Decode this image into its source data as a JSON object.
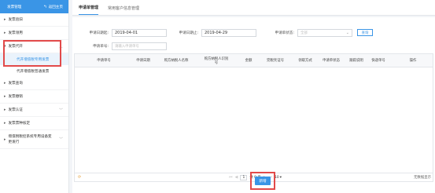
{
  "sidebar": {
    "title": "发票管理",
    "back_label": "返回主页",
    "items": [
      {
        "label": "发票验旧",
        "expanded": false
      },
      {
        "label": "发票领用",
        "expanded": false
      },
      {
        "label": "发票代开",
        "expanded": true
      },
      {
        "label": "发票查询",
        "expanded": false
      },
      {
        "label": "发票缴销",
        "expanded": false
      },
      {
        "label": "发票认证",
        "expanded": false
      },
      {
        "label": "发票票种核定",
        "expanded": false
      },
      {
        "label": "增值税税控系统专用设备变更发行",
        "expanded": false
      }
    ],
    "subitems": [
      {
        "label": "代开增值税专用发票",
        "active": true
      },
      {
        "label": "代开增值税普通发票",
        "active": false
      }
    ]
  },
  "tabs": [
    {
      "label": "申请单管理",
      "active": true
    },
    {
      "label": "常用客户信息管理",
      "active": false
    }
  ],
  "form": {
    "start_date_label": "申请日期起:",
    "start_date": "2019-04-01",
    "end_date_label": "申请日期止:",
    "end_date": "2019-04-29",
    "status_label": "申请单状态:",
    "status_value": "全部",
    "search_label": "查询",
    "apply_no_label": "申请单号:",
    "apply_no_placeholder": "请输入申请单号"
  },
  "table": {
    "columns": [
      "申请单号",
      "申请日期",
      "购方纳税人名称",
      "购方纳税人识别号",
      "金额",
      "完税凭证号",
      "领取方式",
      "申请单状态",
      "跟踪说明",
      "快递单号",
      "操作"
    ],
    "pager": {
      "prev_first": "⏮",
      "prev": "◀",
      "page": "1",
      "total_text": "共 0 页",
      "next": "▶",
      "next_last": "⏭",
      "page_size": "10"
    },
    "empty_text": "无数据显示"
  },
  "add_button_label": "新增",
  "colors": {
    "accent": "#3a95e6",
    "highlight": "#e24a4a"
  }
}
